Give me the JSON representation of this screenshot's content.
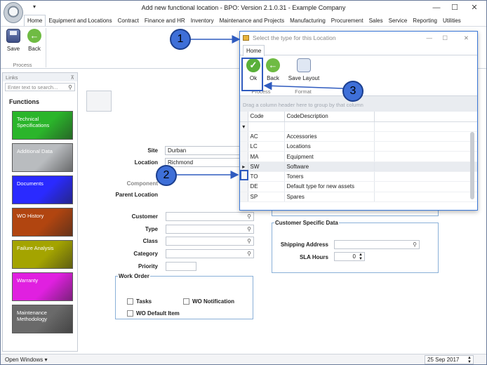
{
  "app": {
    "title": "Add new functional location - BPO: Version 2.1.0.31 - Example Company",
    "qat": "▾"
  },
  "tabs": [
    "Home",
    "Equipment and Locations",
    "Contract",
    "Finance and HR",
    "Inventory",
    "Maintenance and Projects",
    "Manufacturing",
    "Procurement",
    "Sales",
    "Service",
    "Reporting",
    "Utilities"
  ],
  "ribbon": {
    "save": "Save",
    "back": "Back",
    "group": "Process"
  },
  "links": {
    "header": "Links",
    "search_placeholder": "Enter text to search...",
    "section": "Functions",
    "tiles": [
      {
        "label": "Technical Specifications",
        "color": "#2bb52b"
      },
      {
        "label": "Additional Data",
        "color": "#b9bcbf"
      },
      {
        "label": "Documents",
        "color": "#2a2aff"
      },
      {
        "label": "WO History",
        "color": "#b14510"
      },
      {
        "label": "Failure Analysis",
        "color": "#a4a400"
      },
      {
        "label": "Warranty",
        "color": "#e020e0"
      },
      {
        "label": "Maintenance Methodology",
        "color": "#6a6a6a"
      }
    ]
  },
  "form": {
    "site_label": "Site",
    "site_value": "Durban",
    "location_label": "Location",
    "location_value": "Richmond",
    "component_label": "Component",
    "parent_location_label": "Parent Location",
    "customer_label": "Customer",
    "type_label": "Type",
    "class_label": "Class",
    "category_label": "Category",
    "priority_label": "Priority",
    "work_order_legend": "Work Order",
    "tasks_label": "Tasks",
    "wo_notification_label": "WO Notification",
    "wo_default_item_label": "WO Default Item",
    "customer_specific_legend": "Customer Specific Data",
    "shipping_address_label": "Shipping Address",
    "sla_hours_label": "SLA Hours",
    "sla_hours_value": "0"
  },
  "statusbar": {
    "open_windows": "Open Windows ▾",
    "date": "25 Sep 2017"
  },
  "dialog": {
    "title": "Select the type for this Location",
    "tab": "Home",
    "ok": "Ok",
    "back": "Back",
    "save_layout": "Save Layout",
    "group_process": "Process",
    "group_format": "Format",
    "group_panel_hint": "Drag a column header here to group by that column",
    "columns": [
      "Code",
      "CodeDescription"
    ],
    "rows": [
      {
        "code": "AC",
        "desc": "Accessories"
      },
      {
        "code": "LC",
        "desc": "Locations"
      },
      {
        "code": "MA",
        "desc": "Equipment"
      },
      {
        "code": "SW",
        "desc": "Software"
      },
      {
        "code": "TO",
        "desc": "Toners"
      },
      {
        "code": "DE",
        "desc": "Default type for new assets"
      },
      {
        "code": "SP",
        "desc": "Spares"
      }
    ],
    "selected_code": "SW"
  },
  "callouts": [
    "1",
    "2",
    "3"
  ]
}
